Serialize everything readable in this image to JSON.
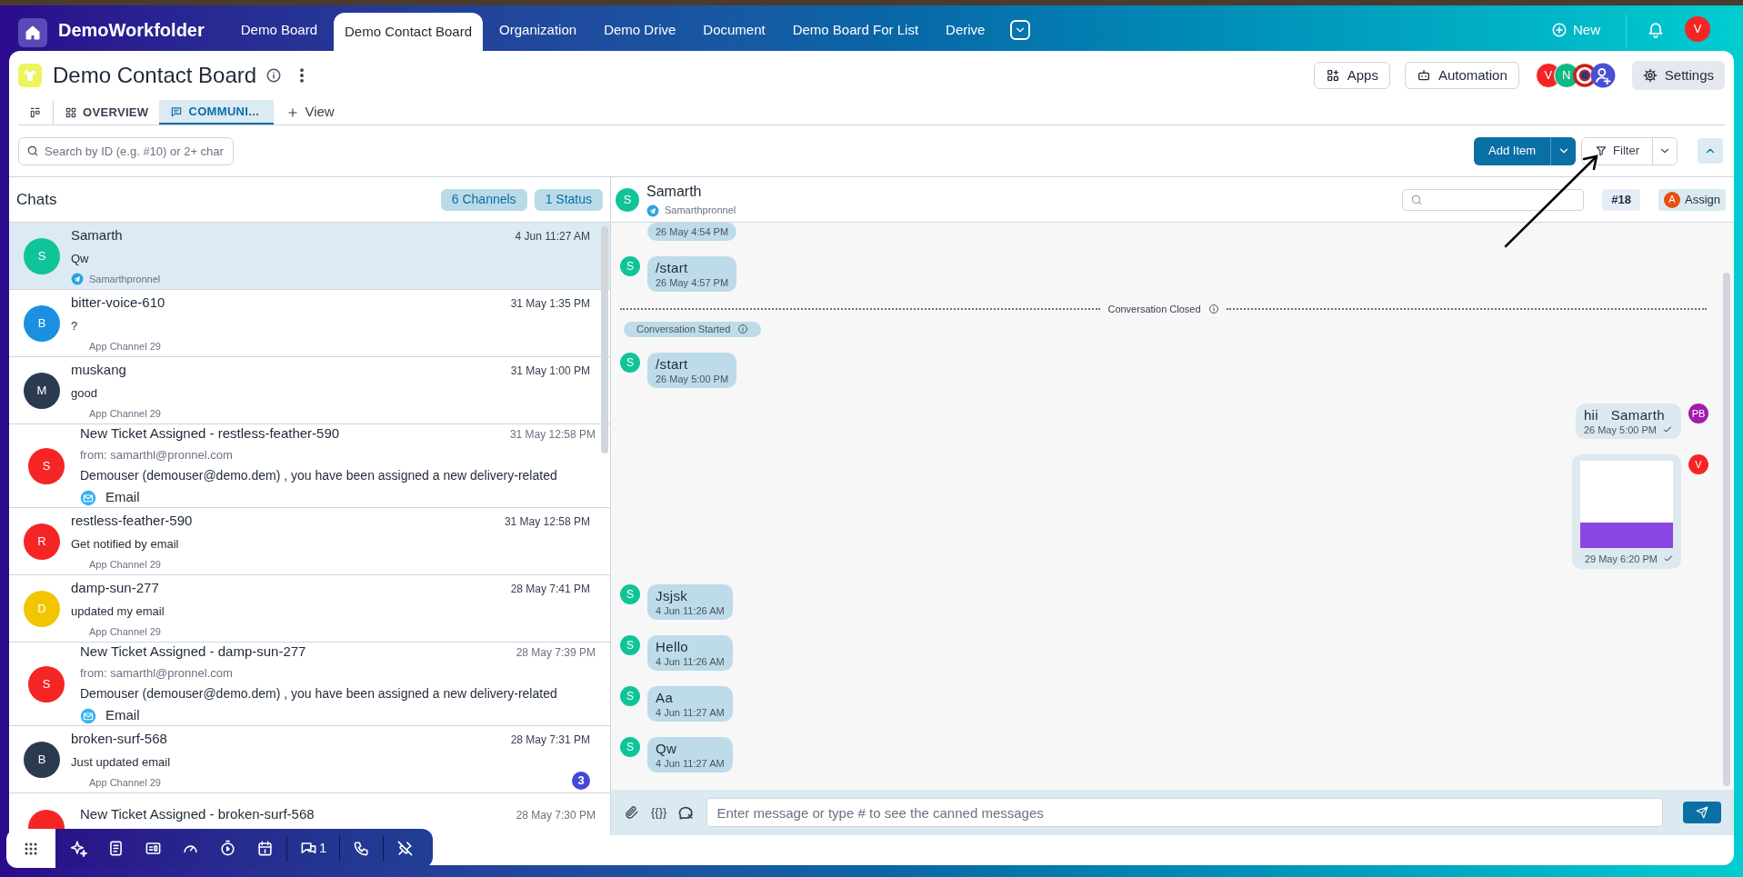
{
  "app": {
    "name": "DemoWorkfolder"
  },
  "nav_tabs": [
    {
      "label": "Demo Board",
      "selected": false
    },
    {
      "label": "Demo Contact Board",
      "selected": true
    },
    {
      "label": "Organization",
      "selected": false
    },
    {
      "label": "Demo Drive",
      "selected": false
    },
    {
      "label": "Document",
      "selected": false
    },
    {
      "label": "Demo Board For List",
      "selected": false
    },
    {
      "label": "Derive",
      "selected": false
    }
  ],
  "nav_actions": {
    "new_label": "New",
    "user_initial": "V"
  },
  "board": {
    "title": "Demo Contact Board",
    "apps": "Apps",
    "automation": "Automation",
    "settings": "Settings",
    "members": [
      {
        "initial": "V",
        "color": "#f52525"
      },
      {
        "initial": "N",
        "color": "#10b981"
      }
    ]
  },
  "view_tabs": [
    {
      "kind": "layout",
      "selected": false
    },
    {
      "kind": "overview",
      "label": "OVERVIEW",
      "selected": false
    },
    {
      "kind": "communication",
      "label": "COMMUNI...",
      "selected": true
    }
  ],
  "add_view_label": "View",
  "toolbar": {
    "search_placeholder": "Search by ID (e.g. #10) or 2+ char",
    "add_item": "Add Item",
    "filter": "Filter"
  },
  "chats": {
    "title": "Chats",
    "chips": [
      "6 Channels",
      "1 Status"
    ],
    "items": [
      {
        "kind": "chat",
        "initial": "S",
        "color": "#10c49a",
        "name": "Samarth",
        "time": "4 Jun 11:27 AM",
        "preview": "Qw",
        "channel": {
          "kind": "telegram",
          "label": "Samarthpronnel"
        },
        "selected": true
      },
      {
        "kind": "chat",
        "initial": "B",
        "color": "#1b8fe0",
        "name": "bitter-voice-610",
        "time": "31 May 1:35 PM",
        "preview": "?",
        "channel": {
          "kind": "app",
          "label": "App Channel 29"
        },
        "selected": false
      },
      {
        "kind": "chat",
        "initial": "M",
        "color": "#2b3a4e",
        "name": "muskang",
        "time": "31 May 1:00 PM",
        "preview": "good",
        "channel": {
          "kind": "app",
          "label": "App Channel 29"
        },
        "selected": false
      },
      {
        "kind": "ticket",
        "initial": "S",
        "color": "#f52525",
        "name": "New Ticket Assigned - restless-feather-590",
        "time": "31 May 12:58 PM",
        "from": "from: samarthl@pronnel.com",
        "preview": "Demouser (demouser@demo.dem) , you have been assigned a new delivery-related",
        "channel": {
          "kind": "email",
          "label": "Email"
        },
        "selected": false
      },
      {
        "kind": "chat",
        "initial": "R",
        "color": "#f52525",
        "name": "restless-feather-590",
        "time": "31 May 12:58 PM",
        "preview": "Get notified by email",
        "channel": {
          "kind": "app",
          "label": "App Channel 29"
        },
        "selected": false
      },
      {
        "kind": "chat",
        "initial": "D",
        "color": "#f2c500",
        "name": "damp-sun-277",
        "time": "28 May 7:41 PM",
        "preview": "updated my email",
        "channel": {
          "kind": "app",
          "label": "App Channel 29"
        },
        "selected": false
      },
      {
        "kind": "ticket",
        "initial": "S",
        "color": "#f52525",
        "name": "New Ticket Assigned - damp-sun-277",
        "time": "28 May 7:39 PM",
        "from": "from: samarthl@pronnel.com",
        "preview": "Demouser (demouser@demo.dem) , you have been assigned a new delivery-related",
        "channel": {
          "kind": "email",
          "label": "Email"
        },
        "selected": false
      },
      {
        "kind": "chat",
        "initial": "B",
        "color": "#2b3a4e",
        "name": "broken-surf-568",
        "time": "28 May 7:31 PM",
        "preview": "Just updated email",
        "channel": {
          "kind": "app",
          "label": "App Channel 29"
        },
        "unread": "3",
        "selected": false
      },
      {
        "kind": "ticket",
        "color": "#f52525",
        "name": "New Ticket Assigned - broken-surf-568",
        "time": "28 May 7:30 PM",
        "selected": false
      }
    ]
  },
  "conversation": {
    "initial": "S",
    "color": "#10c49a",
    "name": "Samarth",
    "channel": {
      "kind": "telegram",
      "label": "Samarthpronnel"
    },
    "ticket": "#18",
    "assign_initial": "A",
    "assign_label": "Assign",
    "messages": [
      {
        "kind": "incoming",
        "time": "26 May 4:54 PM"
      },
      {
        "kind": "incoming",
        "initial": "S",
        "color": "#10c49a",
        "text": "/start",
        "time": "26 May 4:57 PM"
      },
      {
        "kind": "divider",
        "text": "Conversation Closed"
      },
      {
        "kind": "event",
        "text": "Conversation Started"
      },
      {
        "kind": "incoming",
        "initial": "S",
        "color": "#10c49a",
        "text": "/start",
        "time": "26 May 5:00 PM"
      },
      {
        "kind": "outgoing",
        "initial": "PB",
        "color": "#a21caf",
        "text": "hii   Samarth",
        "time": "26 May 5:00 PM",
        "delivered": true
      },
      {
        "kind": "image",
        "initial": "V",
        "color": "#f52525",
        "time": "29 May 6:20 PM",
        "delivered": true
      },
      {
        "kind": "incoming",
        "initial": "S",
        "color": "#10c49a",
        "text": "Jsjsk",
        "time": "4 Jun 11:26 AM"
      },
      {
        "kind": "incoming",
        "initial": "S",
        "color": "#10c49a",
        "text": "Hello",
        "time": "4 Jun 11:26 AM"
      },
      {
        "kind": "incoming",
        "initial": "S",
        "color": "#10c49a",
        "text": "Aa",
        "time": "4 Jun 11:27 AM"
      },
      {
        "kind": "incoming",
        "initial": "S",
        "color": "#10c49a",
        "text": "Qw",
        "time": "4 Jun 11:27 AM"
      }
    ]
  },
  "composer": {
    "variables_label": "{{}}",
    "placeholder": "Enter message or type # to see the canned messages"
  },
  "dock": {
    "chat_count": "1"
  }
}
